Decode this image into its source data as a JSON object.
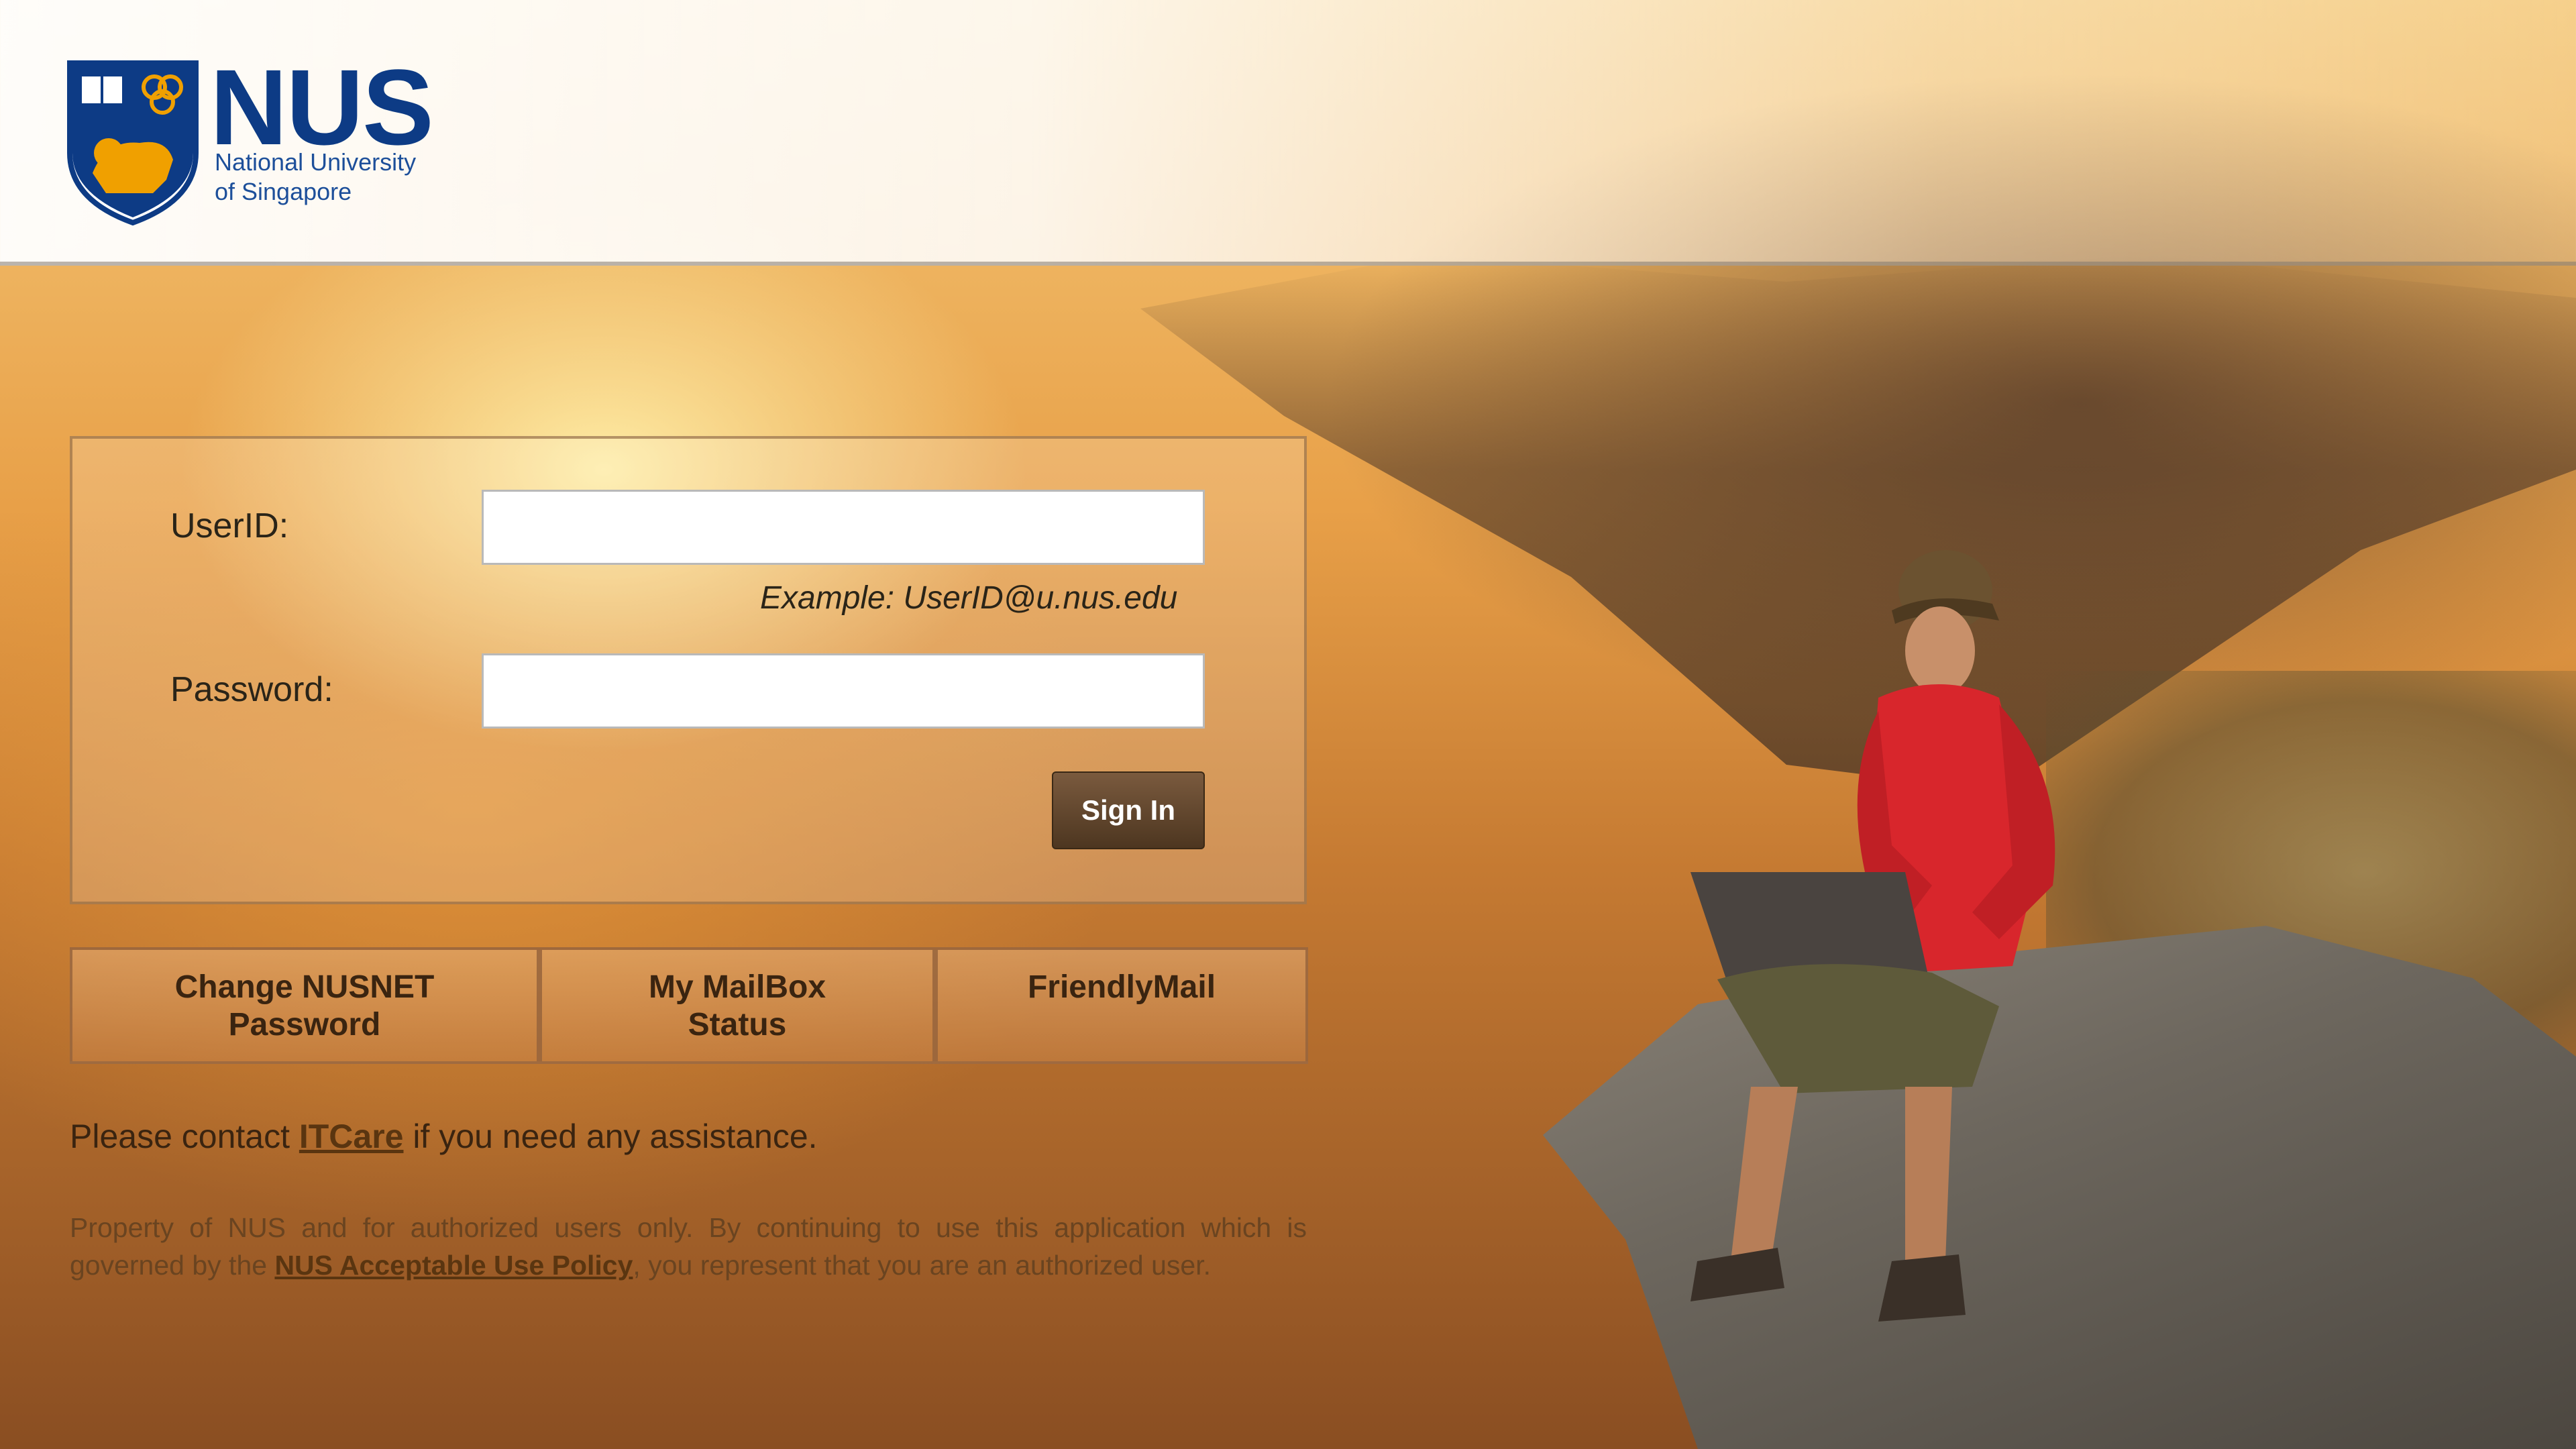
{
  "header": {
    "logo_abbrev": "NUS",
    "logo_line1": "National University",
    "logo_line2": "of Singapore"
  },
  "login": {
    "userid_label": "UserID:",
    "userid_value": "",
    "userid_example": "Example: UserID@u.nus.edu",
    "password_label": "Password:",
    "password_value": "",
    "signin_label": "Sign In"
  },
  "links": [
    {
      "line1": "Change NUSNET",
      "line2": "Password"
    },
    {
      "line1": "My MailBox",
      "line2": "Status"
    },
    {
      "line1": "FriendlyMail",
      "line2": ""
    }
  ],
  "contact": {
    "prefix": "Please contact ",
    "link": "ITCare",
    "suffix": " if you need any assistance."
  },
  "legal": {
    "prefix": "Property of NUS and for authorized users only. By continuing to use this application which is governed by the ",
    "link": "NUS Acceptable Use Policy",
    "suffix": ", you represent that you are an authorized user."
  },
  "colors": {
    "nus_blue": "#0d3b85",
    "signin_brown": "#5a3e24"
  }
}
